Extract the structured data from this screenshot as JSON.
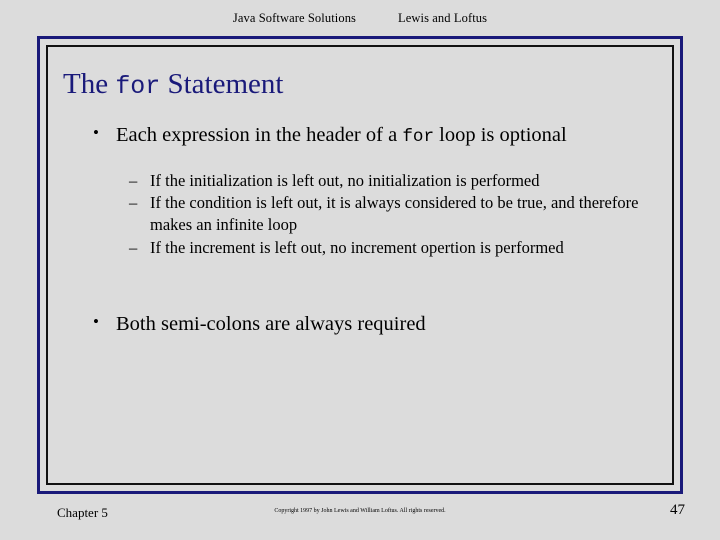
{
  "header": {
    "left_text": "Java Software Solutions",
    "right_text": "Lewis and Loftus"
  },
  "slide": {
    "title": {
      "prefix": "The ",
      "keyword": "for",
      "suffix": " Statement"
    },
    "bullet_1": {
      "marker": "•",
      "prefix": "Each expression in the header of a ",
      "keyword": "for",
      "suffix": " loop is optional"
    },
    "sub_bullets": [
      {
        "marker": "–",
        "text": "If the initialization is left out, no initialization is performed"
      },
      {
        "marker": "–",
        "text": "If the condition is left out, it is always considered to be true, and therefore makes an infinite loop"
      },
      {
        "marker": "–",
        "text": "If the increment is left out, no increment opertion is performed"
      }
    ],
    "bullet_2": {
      "marker": "•",
      "text": "Both semi-colons are always required"
    }
  },
  "footer": {
    "chapter": "Chapter 5",
    "copyright": "Copyright 1997 by John Lewis and William Loftus.  All rights reserved.",
    "page_number": "47"
  },
  "colors": {
    "background": "#dcdcdc",
    "outer_border": "#1a1a7a",
    "inner_border": "#111111",
    "title": "#1a1a7a",
    "body_text": "#000000"
  }
}
